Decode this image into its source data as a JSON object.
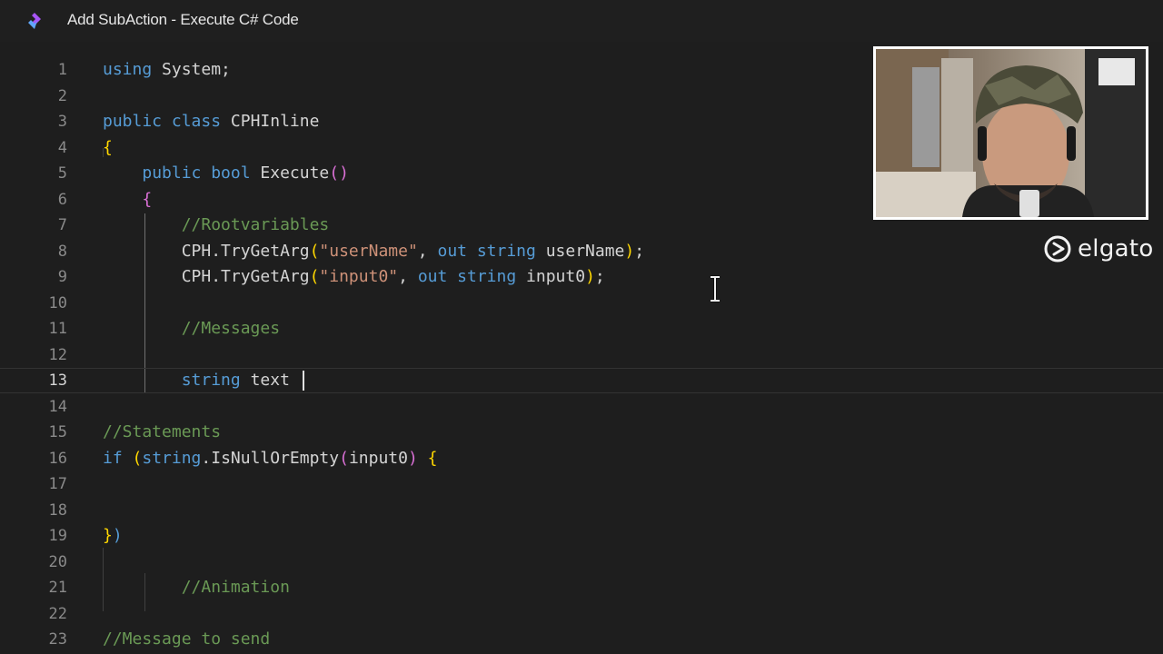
{
  "window": {
    "title": "Add SubAction - Execute C# Code",
    "icon": "streamerbot-logo-icon"
  },
  "editor": {
    "language": "C#",
    "current_line": 13,
    "lines": [
      {
        "number": "1",
        "tokens": [
          {
            "text": "using ",
            "class": "kw"
          },
          {
            "text": "System;",
            "class": "tp"
          }
        ]
      },
      {
        "number": "2",
        "tokens": []
      },
      {
        "number": "3",
        "tokens": [
          {
            "text": "public class ",
            "class": "kw"
          },
          {
            "text": "CPHInline",
            "class": "tp"
          }
        ]
      },
      {
        "number": "4",
        "tokens": [
          {
            "text": "{",
            "class": "br1"
          }
        ]
      },
      {
        "number": "5",
        "tokens": [
          {
            "text": "    ",
            "class": "tp"
          },
          {
            "text": "public bool ",
            "class": "kw"
          },
          {
            "text": "Execute",
            "class": "tp"
          },
          {
            "text": "()",
            "class": "br2"
          }
        ]
      },
      {
        "number": "6",
        "tokens": [
          {
            "text": "    ",
            "class": "tp"
          },
          {
            "text": "{",
            "class": "br2"
          }
        ]
      },
      {
        "number": "7",
        "tokens": [
          {
            "text": "        ",
            "class": "tp"
          },
          {
            "text": "//Rootvariables",
            "class": "cm"
          }
        ]
      },
      {
        "number": "8",
        "tokens": [
          {
            "text": "        CPH.TryGetArg",
            "class": "tp"
          },
          {
            "text": "(",
            "class": "br1"
          },
          {
            "text": "\"userName\"",
            "class": "str"
          },
          {
            "text": ", ",
            "class": "tp"
          },
          {
            "text": "out string ",
            "class": "kw"
          },
          {
            "text": "userName",
            "class": "tp"
          },
          {
            "text": ")",
            "class": "br1"
          },
          {
            "text": ";",
            "class": "tp"
          }
        ]
      },
      {
        "number": "9",
        "tokens": [
          {
            "text": "        CPH.TryGetArg",
            "class": "tp"
          },
          {
            "text": "(",
            "class": "br1"
          },
          {
            "text": "\"input0\"",
            "class": "str"
          },
          {
            "text": ", ",
            "class": "tp"
          },
          {
            "text": "out string ",
            "class": "kw"
          },
          {
            "text": "input0",
            "class": "tp"
          },
          {
            "text": ")",
            "class": "br1"
          },
          {
            "text": ";",
            "class": "tp"
          }
        ]
      },
      {
        "number": "10",
        "tokens": []
      },
      {
        "number": "11",
        "tokens": [
          {
            "text": "        ",
            "class": "tp"
          },
          {
            "text": "//Messages",
            "class": "cm"
          }
        ]
      },
      {
        "number": "12",
        "tokens": []
      },
      {
        "number": "13",
        "tokens": [
          {
            "text": "        ",
            "class": "tp"
          },
          {
            "text": "string ",
            "class": "kw"
          },
          {
            "text": "text",
            "class": "tp"
          }
        ]
      },
      {
        "number": "14",
        "tokens": []
      },
      {
        "number": "15",
        "tokens": [
          {
            "text": "//Statements",
            "class": "cm"
          }
        ]
      },
      {
        "number": "16",
        "tokens": [
          {
            "text": "if ",
            "class": "kw"
          },
          {
            "text": "(",
            "class": "br1"
          },
          {
            "text": "string",
            "class": "kw"
          },
          {
            "text": ".IsNullOrEmpty",
            "class": "tp"
          },
          {
            "text": "(",
            "class": "br2"
          },
          {
            "text": "input0",
            "class": "tp"
          },
          {
            "text": ")",
            "class": "br2"
          },
          {
            "text": " ",
            "class": "tp"
          },
          {
            "text": "{",
            "class": "br1"
          }
        ]
      },
      {
        "number": "17",
        "tokens": []
      },
      {
        "number": "18",
        "tokens": []
      },
      {
        "number": "19",
        "tokens": [
          {
            "text": "}",
            "class": "br1"
          },
          {
            "text": ")",
            "class": "kw"
          }
        ]
      },
      {
        "number": "20",
        "tokens": []
      },
      {
        "number": "21",
        "tokens": [
          {
            "text": "        ",
            "class": "tp"
          },
          {
            "text": "//Animation",
            "class": "cm"
          }
        ]
      },
      {
        "number": "22",
        "tokens": []
      },
      {
        "number": "23",
        "tokens": [
          {
            "text": "//Message to send",
            "class": "cm"
          }
        ]
      }
    ]
  },
  "overlay": {
    "brand": "elgato",
    "brand_icon": "elgato-logo-icon",
    "webcam": "webcam-feed"
  },
  "colors": {
    "keyword": "#569cd6",
    "string": "#ce9178",
    "comment": "#6a9955",
    "bracket_gold": "#ffd700",
    "bracket_purple": "#da70d6",
    "background": "#1e1e1e"
  }
}
